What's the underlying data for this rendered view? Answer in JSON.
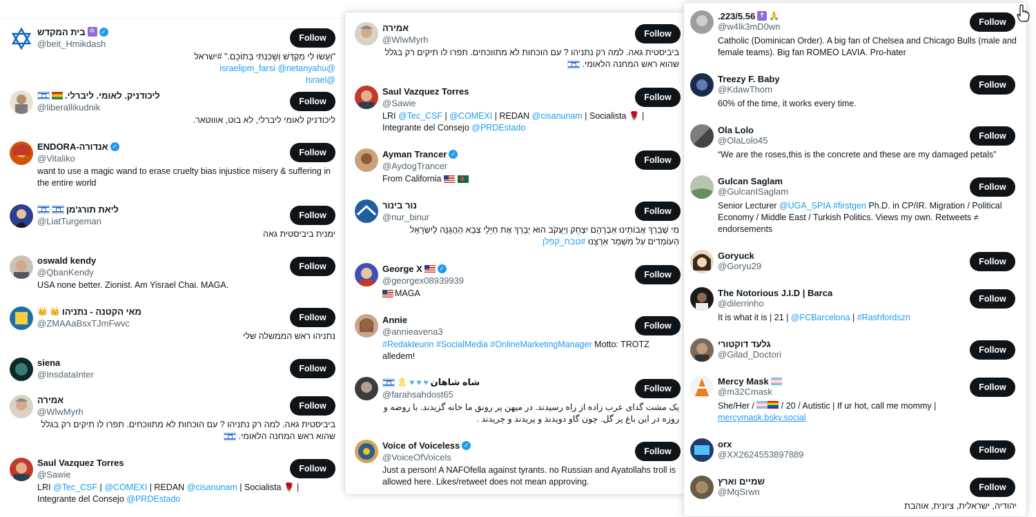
{
  "follow_label": "Follow",
  "colors": {
    "accent": "#1d9bf0",
    "button": "#0f1419",
    "muted": "#536471"
  },
  "panel1": [
    {
      "name": "בית המקדש",
      "handle": "@beit_Hmikdash",
      "bio_a": "\"וְעָשׂוּ לִי מִקְדָּשׁ וְשָׁכַנְתִּי בְּתוֹכָם.\" #ישראל",
      "bio_b": "@israelipm_farsi @netanyahu",
      "bio_c": "@Israel"
    },
    {
      "name": ".ליכודניק. לאומי. ליברלי",
      "handle": "@liberallikudnik",
      "bio": "ליכודניק לאומי ליברלי, לא בוט, אוווטאר."
    },
    {
      "name": "ENDORA-אנדורה",
      "handle": "@Vitaliko",
      "bio": "want to use a magic wand to erase cruelty bias injustice misery & suffering in the entire world"
    },
    {
      "name": "ליאת תורג'מן",
      "handle": "@LiatTurgeman",
      "bio": "ימנית ביביסטית גאה"
    },
    {
      "name": "oswald kendy",
      "handle": "@QbanKendy",
      "bio": "USA none better. Zionist. Am Yisrael Chai. MAGA."
    },
    {
      "name": "מאי הקטנה - נתניהו",
      "handle": "@ZMAAaBsxTJmFwvc",
      "bio": "נתניהו ראש הממשלה שלי"
    },
    {
      "name": "siena",
      "handle": "@InsdataInter",
      "bio": ""
    },
    {
      "name": "אמירה",
      "handle": "@WlwMyrh",
      "bio": "ביביסטית גאה. למה רק נתניהו ? עם הוכחות לא מתווכחים. תפרו לו תיקים רק בגלל שהוא ראש המחנה הלאומי."
    },
    {
      "name": "Saul Vazquez Torres",
      "handle": "@Sawie",
      "bio_pre": "LRI ",
      "l1": "@Tec_CSF",
      "s1": " | ",
      "l2": "@COMEXI",
      "s2": " | REDAN ",
      "l3": "@cisanunam",
      "s3": " | Socialista 🌹 | Integrante del Consejo ",
      "l4": "@PRDEstado"
    }
  ],
  "panel2": [
    {
      "name": "אמירה",
      "handle": "@WlwMyrh",
      "bio": "ביביסטית גאה. למה רק נתניהו ? עם הוכחות לא מתווכחים. תפרו לו תיקים רק בגלל שהוא ראש המחנה הלאומי."
    },
    {
      "name": "Saul Vazquez Torres",
      "handle": "@Sawie",
      "bio_pre": "LRI ",
      "l1": "@Tec_CSF",
      "s1": " | ",
      "l2": "@COMEXI",
      "s2": " | REDAN ",
      "l3": "@cisanunam",
      "s3": " | Socialista 🌹 | Integrante del Consejo ",
      "l4": "@PRDEstado"
    },
    {
      "name": "Ayman Trancer",
      "handle": "@AydogTrancer",
      "bio": "From California"
    },
    {
      "name": "נור בינור",
      "handle": "@nur_binur",
      "bio": "מִי שֶׁבֵּרַךְ אֲבוֹתֵינוּ אַבְרָהָם יִצְחָק וְיַעֲקֹב הוּא יְבָרֵךְ אֶת חַיָּלֵי צְבָא הַהֲגָנָּה לְיִשְׂרָאֵל הָעוֹמְדִים עַל מִשְׁמַר אַרְצֵנוּ",
      "bio_link": "#טבח_קפלן"
    },
    {
      "name": "George X",
      "handle": "@georgex08939939",
      "bio": "MAGA"
    },
    {
      "name": "Annie",
      "handle": "@annieavena3",
      "l1": "#Redakteurin",
      "l2": "#SocialMedia",
      "l3": "#OnlineMarketingManager",
      "bio": " Motto: TROTZ alledem!"
    },
    {
      "name": "شاه شاهان",
      "handle": "@farahsahdost65",
      "bio": "یک مشت گدای عرب زاده از راه رسیدند. در میهن پر رونق ما خانه گزیدند. با روضه و روزه در این باغ پر گل. چون گاو دویدند و پریدند و چریدند ."
    },
    {
      "name": "Voice of Voiceless",
      "handle": "@VoiceOfVoicels",
      "bio": "Just a person! A NAFOfella against tyrants. no Russian and Ayatollahs troll is allowed here. Likes/retweet does not mean approving."
    }
  ],
  "panel3": [
    {
      "name": ".223/5.56",
      "handle": "@w4lk3mD0wn",
      "bio": "Catholic (Dominican Order). A big fan of Chelsea and Chicago Bulls (male and female teams). Big fan ROMEO LAVIA. Pro-hater"
    },
    {
      "name": "Treezy F. Baby",
      "handle": "@KdawThom",
      "bio": "60% of the time, it works every time."
    },
    {
      "name": "Ola Lolo",
      "handle": "@OlaLolo45",
      "bio": "“We are the roses,this is the concrete and these are my damaged petals”"
    },
    {
      "name": "Gulcan Saglam",
      "handle": "@GulcanISaglam",
      "bio_pre": "Senior Lecturer ",
      "l1": "@UGA_SPIA",
      "l2": "#firstgen",
      "bio": " Ph.D. in CP/IR. Migration / Political Economy / Middle East / Turkish Politics. Views my own. Retweets ≠ endorsements"
    },
    {
      "name": "Goryuck",
      "handle": "@Goryu29",
      "bio": ""
    },
    {
      "name": "The Notorious J.I.D | Barca",
      "handle": "@dilerrinho",
      "bio_pre": "It is what it is | 21 | ",
      "l1": "@FCBarcelona",
      "s1": " | ",
      "l2": "#Rashfordszn"
    },
    {
      "name": "גלעד דוקטורי",
      "handle": "@Gilad_Doctori",
      "bio": ""
    },
    {
      "name": "Mercy Mask",
      "handle": "@m32Cmask",
      "bio": "She/Her / ",
      "bio_b": " / 20 / Autistic | If ur hot, call me mommy |",
      "l1": "mercymask.bsky.social"
    },
    {
      "name": "orx",
      "handle": "@XX2624553897889",
      "bio": ""
    },
    {
      "name": "שמיים וארץ",
      "handle": "@MqSrwn",
      "bio": "יהודיה, ישראלית, ציונית, אוהבת"
    }
  ]
}
